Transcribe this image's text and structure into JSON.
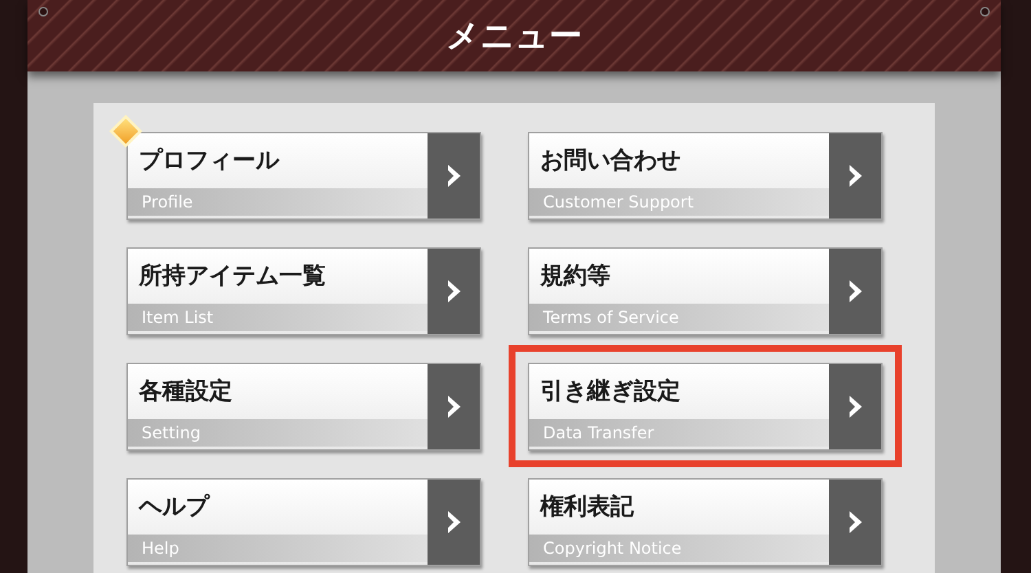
{
  "title": "メニュー",
  "items": [
    {
      "label": "プロフィール",
      "sublabel": "Profile",
      "new_badge": true,
      "highlighted": false
    },
    {
      "label": "お問い合わせ",
      "sublabel": "Customer Support",
      "new_badge": false,
      "highlighted": false
    },
    {
      "label": "所持アイテム一覧",
      "sublabel": "Item List",
      "new_badge": false,
      "highlighted": false
    },
    {
      "label": "規約等",
      "sublabel": "Terms of Service",
      "new_badge": false,
      "highlighted": false
    },
    {
      "label": "各種設定",
      "sublabel": "Setting",
      "new_badge": false,
      "highlighted": false
    },
    {
      "label": "引き継ぎ設定",
      "sublabel": "Data Transfer",
      "new_badge": false,
      "highlighted": true
    },
    {
      "label": "ヘルプ",
      "sublabel": "Help",
      "new_badge": false,
      "highlighted": false
    },
    {
      "label": "権利表記",
      "sublabel": "Copyright Notice",
      "new_badge": false,
      "highlighted": false
    }
  ]
}
